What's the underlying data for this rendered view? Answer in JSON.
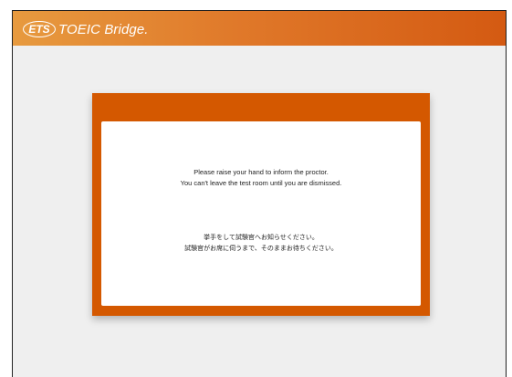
{
  "header": {
    "ets_mark": "ETS",
    "brand_name": "TOEIC Bridge.",
    "colors": {
      "gradient_start": "#e79a3f",
      "gradient_end": "#d45a12"
    }
  },
  "modal": {
    "border_color": "#d45800",
    "english": {
      "line1": "Please raise your hand to inform the proctor.",
      "line2": "You can't leave the test room until you are dismissed."
    },
    "japanese": {
      "line1": "挙手をして試験官へお知らせください。",
      "line2": "試験官がお席に伺うまで、そのままお待ちください。"
    }
  }
}
